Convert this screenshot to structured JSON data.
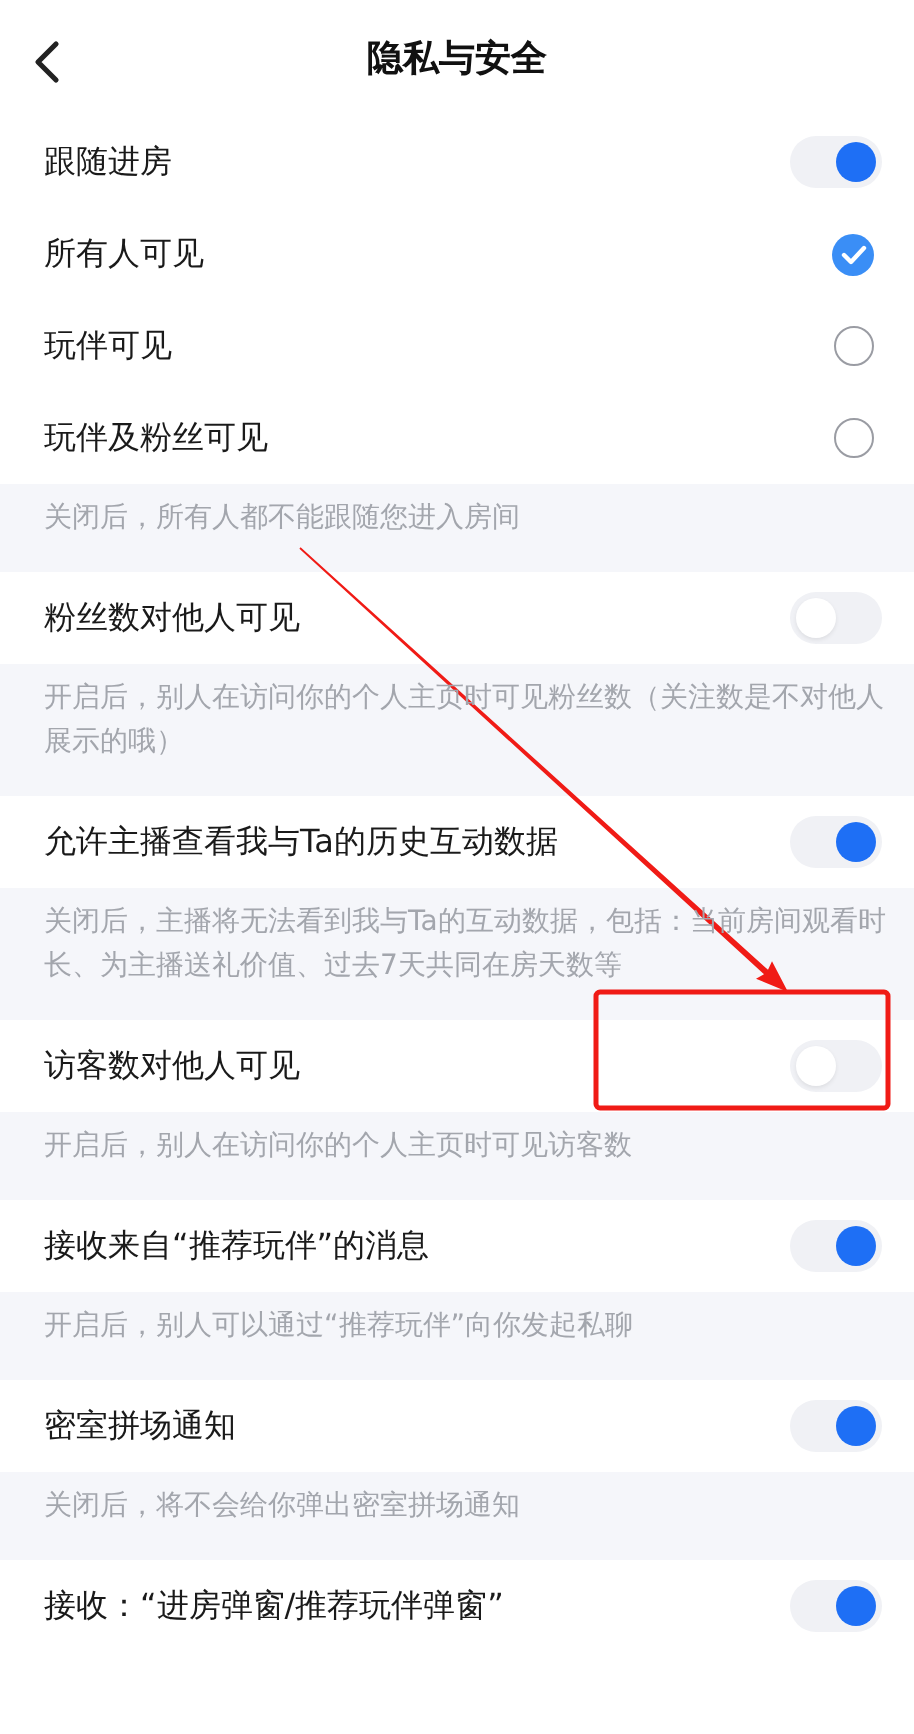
{
  "header": {
    "title": "隐私与安全"
  },
  "items": [
    {
      "kind": "toggle",
      "label": "跟随进房",
      "on": true
    },
    {
      "kind": "radio",
      "label": "所有人可见",
      "selected": true
    },
    {
      "kind": "radio",
      "label": "玩伴可见",
      "selected": false
    },
    {
      "kind": "radio",
      "label": "玩伴及粉丝可见",
      "selected": false
    },
    {
      "kind": "hint",
      "text": "关闭后，所有人都不能跟随您进入房间"
    },
    {
      "kind": "toggle",
      "label": "粉丝数对他人可见",
      "on": false
    },
    {
      "kind": "hint",
      "text": "开启后，别人在访问你的个人主页时可见粉丝数（关注数是不对他人展示的哦）"
    },
    {
      "kind": "toggle",
      "label": "允许主播查看我与Ta的历史互动数据",
      "on": true
    },
    {
      "kind": "hint",
      "text": "关闭后，主播将无法看到我与Ta的互动数据，包括：当前房间观看时长、为主播送礼价值、过去7天共同在房天数等"
    },
    {
      "kind": "toggle",
      "label": "访客数对他人可见",
      "on": false
    },
    {
      "kind": "hint",
      "text": "开启后，别人在访问你的个人主页时可见访客数"
    },
    {
      "kind": "toggle",
      "label": "接收来自“推荐玩伴”的消息",
      "on": true
    },
    {
      "kind": "hint",
      "text": "开启后，别人可以通过“推荐玩伴”向你发起私聊"
    },
    {
      "kind": "toggle",
      "label": "密室拼场通知",
      "on": true
    },
    {
      "kind": "hint",
      "text": "关闭后，将不会给你弹出密室拼场通知"
    },
    {
      "kind": "toggle",
      "label": "接收：“进房弹窗/推荐玩伴弹窗”",
      "on": true
    }
  ]
}
